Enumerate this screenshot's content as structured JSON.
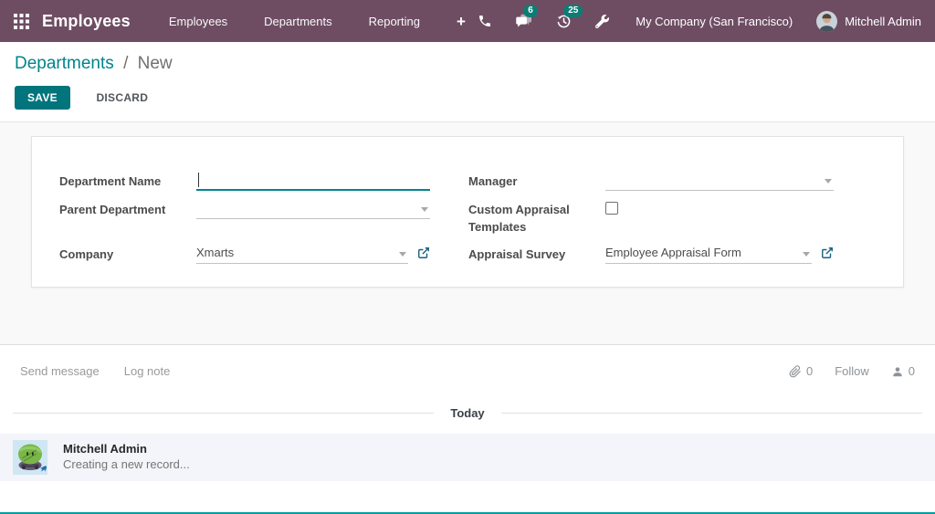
{
  "navbar": {
    "app_name": "Employees",
    "menu_items": [
      {
        "label": "Employees"
      },
      {
        "label": "Departments"
      },
      {
        "label": "Reporting"
      }
    ],
    "quick_add": "+",
    "messages_badge": "6",
    "activities_badge": "25",
    "company": "My Company (San Francisco)",
    "user_name": "Mitchell Admin"
  },
  "breadcrumb": {
    "parent": "Departments",
    "separator": "/",
    "current": "New"
  },
  "actions": {
    "save": "SAVE",
    "discard": "DISCARD"
  },
  "form": {
    "department_name": {
      "label": "Department Name",
      "value": "",
      "focused": true
    },
    "parent_department": {
      "label": "Parent Department",
      "value": ""
    },
    "company": {
      "label": "Company",
      "value": "Xmarts"
    },
    "manager": {
      "label": "Manager",
      "value": ""
    },
    "custom_appraisal_templates": {
      "label": "Custom Appraisal Templates",
      "checked": false
    },
    "appraisal_survey": {
      "label": "Appraisal Survey",
      "value": "Employee Appraisal Form"
    }
  },
  "chatter": {
    "send_message": "Send message",
    "log_note": "Log note",
    "attachments_count": "0",
    "follow_label": "Follow",
    "followers_count": "0",
    "date_divider": "Today",
    "messages": [
      {
        "author": "Mitchell Admin",
        "body": "Creating a new record..."
      }
    ]
  },
  "icons": {
    "apps": "grid-3x3",
    "phone": "phone",
    "messages": "chat-bubbles",
    "activities": "clock-reload",
    "tools": "wrench",
    "attachment": "paperclip",
    "followers": "person",
    "external": "external-link",
    "dropdown": "caret-down"
  },
  "colors": {
    "navbar_bg": "#6e4d63",
    "accent_teal": "#01747c",
    "badge_teal": "#0c7d74",
    "link_blue": "#1b6080",
    "content_bg": "#f9f9f9",
    "message_bg": "#f4f5fa",
    "bottom_line": "#00a09d"
  }
}
